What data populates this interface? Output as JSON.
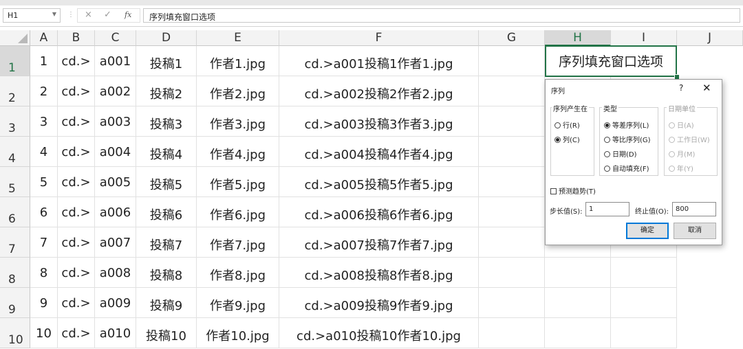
{
  "formula_bar": {
    "name_box": "H1",
    "cancel_icon": "×",
    "enter_icon": "✓",
    "fx_label": "fx",
    "content": "序列填充窗口选项"
  },
  "columns": [
    "A",
    "B",
    "C",
    "D",
    "E",
    "F",
    "G",
    "H",
    "I",
    "J"
  ],
  "rows": [
    {
      "num": "1",
      "cells": [
        "1",
        "cd.>",
        "a001",
        "投稿1",
        "作者1.jpg",
        "cd.>a001投稿1作者1.jpg"
      ]
    },
    {
      "num": "2",
      "cells": [
        "2",
        "cd.>",
        "a002",
        "投稿2",
        "作者2.jpg",
        "cd.>a002投稿2作者2.jpg"
      ]
    },
    {
      "num": "3",
      "cells": [
        "3",
        "cd.>",
        "a003",
        "投稿3",
        "作者3.jpg",
        "cd.>a003投稿3作者3.jpg"
      ]
    },
    {
      "num": "4",
      "cells": [
        "4",
        "cd.>",
        "a004",
        "投稿4",
        "作者4.jpg",
        "cd.>a004投稿4作者4.jpg"
      ]
    },
    {
      "num": "5",
      "cells": [
        "5",
        "cd.>",
        "a005",
        "投稿5",
        "作者5.jpg",
        "cd.>a005投稿5作者5.jpg"
      ]
    },
    {
      "num": "6",
      "cells": [
        "6",
        "cd.>",
        "a006",
        "投稿6",
        "作者6.jpg",
        "cd.>a006投稿6作者6.jpg"
      ]
    },
    {
      "num": "7",
      "cells": [
        "7",
        "cd.>",
        "a007",
        "投稿7",
        "作者7.jpg",
        "cd.>a007投稿7作者7.jpg"
      ]
    },
    {
      "num": "8",
      "cells": [
        "8",
        "cd.>",
        "a008",
        "投稿8",
        "作者8.jpg",
        "cd.>a008投稿8作者8.jpg"
      ]
    },
    {
      "num": "9",
      "cells": [
        "9",
        "cd.>",
        "a009",
        "投稿9",
        "作者9.jpg",
        "cd.>a009投稿9作者9.jpg"
      ]
    },
    {
      "num": "10",
      "cells": [
        "10",
        "cd.>",
        "a010",
        "投稿10",
        "作者10.jpg",
        "cd.>a010投稿10作者10.jpg"
      ]
    }
  ],
  "selected_cell_text": "序列填充窗口选项",
  "dialog": {
    "title": "序列",
    "help": "?",
    "close": "✕",
    "series_in": {
      "label": "序列产生在",
      "options": [
        "行(R)",
        "列(C)"
      ],
      "selected": "列(C)"
    },
    "type": {
      "label": "类型",
      "options": [
        "等差序列(L)",
        "等比序列(G)",
        "日期(D)",
        "自动填充(F)"
      ],
      "selected": "等差序列(L)"
    },
    "date_unit": {
      "label": "日期单位",
      "options": [
        "日(A)",
        "工作日(W)",
        "月(M)",
        "年(Y)"
      ],
      "disabled": true
    },
    "trend": {
      "label": "预测趋势(T)",
      "checked": false
    },
    "step": {
      "label": "步长值(S):",
      "value": "1"
    },
    "stop": {
      "label": "终止值(O):",
      "value": "800"
    },
    "ok": "确定",
    "cancel": "取消"
  },
  "colors": {
    "accent": "#217346",
    "dialog_primary_border": "#0078d7"
  }
}
